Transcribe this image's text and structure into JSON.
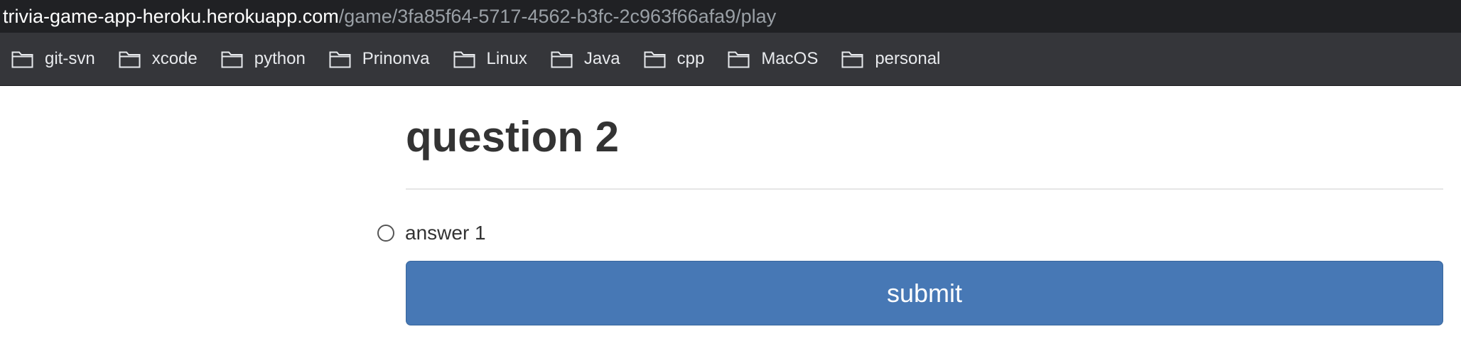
{
  "browser": {
    "url_host": "trivia-game-app-heroku.herokuapp.com",
    "url_path": "/game/3fa85f64-5717-4562-b3fc-2c963f66afa9/play"
  },
  "bookmarks": {
    "icon": "folder-icon",
    "items": [
      {
        "label": "git-svn"
      },
      {
        "label": "xcode"
      },
      {
        "label": "python"
      },
      {
        "label": "Prinonva"
      },
      {
        "label": "Linux"
      },
      {
        "label": "Java"
      },
      {
        "label": "cpp"
      },
      {
        "label": "MacOS"
      },
      {
        "label": "personal"
      }
    ]
  },
  "page": {
    "question_title": "question 2",
    "answers": [
      {
        "label": "answer 1",
        "selected": false
      }
    ],
    "submit_label": "submit",
    "submit_color": "#4778b5"
  }
}
